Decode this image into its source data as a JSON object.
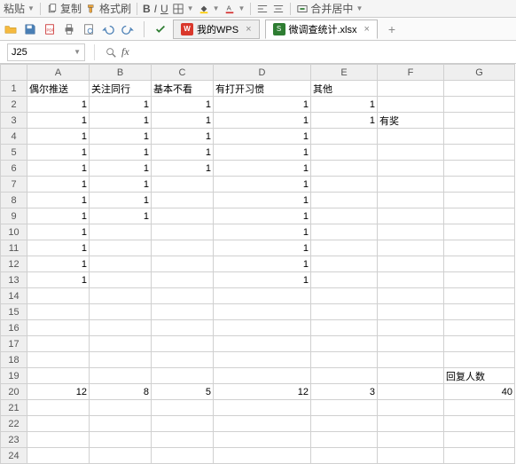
{
  "toolbar1": {
    "paste_label": "粘贴",
    "copy_label": "复制",
    "format_painter_label": "格式刷",
    "merge_center_label": "合并居中"
  },
  "quickbar": {
    "icons": [
      "save",
      "export",
      "pdf",
      "print",
      "preview",
      "undo",
      "redo"
    ]
  },
  "tabs": {
    "wps_label": "我的WPS",
    "file_label": "微调查统计.xlsx"
  },
  "formula_bar": {
    "cell_ref": "J25",
    "fx": "fx",
    "value": ""
  },
  "columns": [
    "A",
    "B",
    "C",
    "D",
    "E",
    "F",
    "G"
  ],
  "row_count": 24,
  "headers": {
    "A": "偶尔推送",
    "B": "关注同行",
    "C": "基本不看",
    "D": "有打开习惯",
    "E": "其他",
    "F": "",
    "G": ""
  },
  "cells": {
    "2": {
      "A": "1",
      "B": "1",
      "C": "1",
      "D": "1",
      "E": "1"
    },
    "3": {
      "A": "1",
      "B": "1",
      "C": "1",
      "D": "1",
      "E": "1",
      "F": "有奖"
    },
    "4": {
      "A": "1",
      "B": "1",
      "C": "1",
      "D": "1"
    },
    "5": {
      "A": "1",
      "B": "1",
      "C": "1",
      "D": "1"
    },
    "6": {
      "A": "1",
      "B": "1",
      "C": "1",
      "D": "1"
    },
    "7": {
      "A": "1",
      "B": "1",
      "D": "1"
    },
    "8": {
      "A": "1",
      "B": "1",
      "D": "1"
    },
    "9": {
      "A": "1",
      "B": "1",
      "D": "1"
    },
    "10": {
      "A": "1",
      "D": "1"
    },
    "11": {
      "A": "1",
      "D": "1"
    },
    "12": {
      "A": "1",
      "D": "1"
    },
    "13": {
      "A": "1",
      "D": "1"
    },
    "19": {
      "G": "回复人数"
    },
    "20": {
      "A": "12",
      "B": "8",
      "C": "5",
      "D": "12",
      "E": "3",
      "G": "40"
    }
  },
  "text_cols": [
    "F"
  ],
  "text_cells": [
    "G19"
  ]
}
